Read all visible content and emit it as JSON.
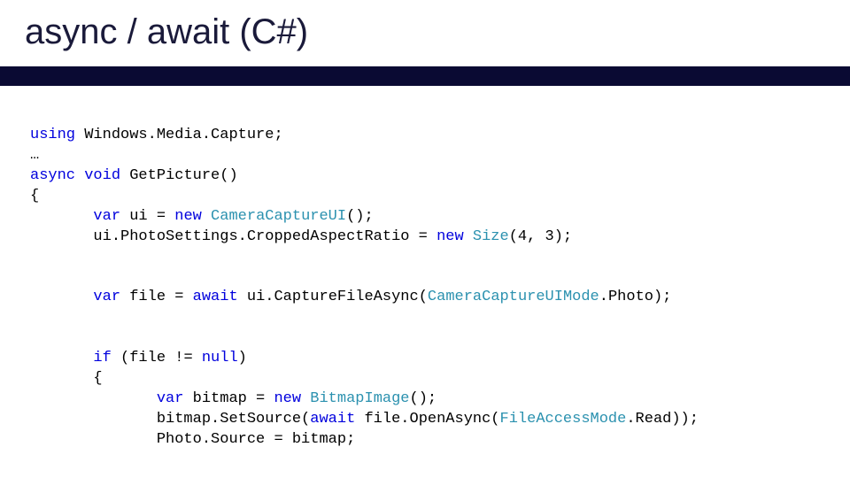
{
  "title": "async / await (C#)",
  "code": {
    "l1": {
      "kw1": "using",
      "t1": " Windows.Media.Capture;"
    },
    "l2": {
      "t1": "…"
    },
    "l3": {
      "kw1": "async",
      "kw2": "void",
      "t1": " GetPicture()"
    },
    "l4": {
      "t1": "{"
    },
    "l5": {
      "kw1": "var",
      "t1": " ui = ",
      "kw2": "new",
      "type1": " CameraCaptureUI",
      "t2": "();"
    },
    "l6": {
      "t1": "ui.PhotoSettings.CroppedAspectRatio = ",
      "kw1": "new",
      "type1": " Size",
      "t2": "(4, 3);"
    },
    "l7": {
      "kw1": "var",
      "t1": " file = ",
      "kw2": "await",
      "t2": " ui.CaptureFileAsync(",
      "type1": "CameraCaptureUIMode",
      "t3": ".Photo);"
    },
    "l8": {
      "kw1": "if",
      "t1": " (file != ",
      "kw2": "null",
      "t2": ")"
    },
    "l9": {
      "t1": "{"
    },
    "l10": {
      "kw1": "var",
      "t1": " bitmap = ",
      "kw2": "new",
      "type1": " BitmapImage",
      "t2": "();"
    },
    "l11": {
      "t1": "bitmap.SetSource(",
      "kw1": "await",
      "t2": " file.OpenAsync(",
      "type1": "FileAccessMode",
      "t3": ".Read));"
    },
    "l12": {
      "t1": "Photo.Source = bitmap;"
    }
  }
}
